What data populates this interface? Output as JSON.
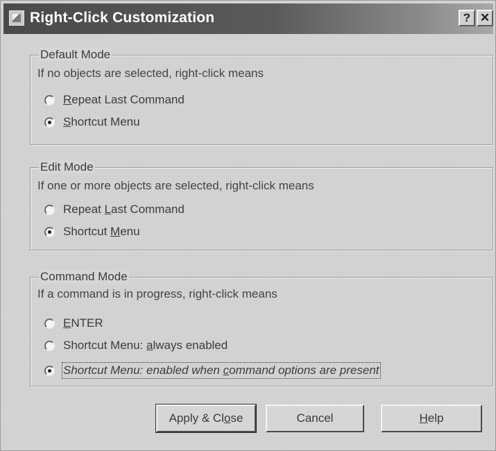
{
  "window": {
    "title": "Right-Click Customization",
    "help_glyph": "?",
    "close_glyph": "✕"
  },
  "default_mode": {
    "legend": "Default Mode",
    "description": "If no objects are selected, right-click means",
    "options": [
      {
        "before": "",
        "mnemonic": "R",
        "after": "epeat Last Command",
        "selected": false
      },
      {
        "before": "",
        "mnemonic": "S",
        "after": "hortcut Menu",
        "selected": true
      }
    ]
  },
  "edit_mode": {
    "legend": "Edit Mode",
    "description": "If one or more objects are selected, right-click means",
    "options": [
      {
        "before": "Repeat ",
        "mnemonic": "L",
        "after": "ast Command",
        "selected": false
      },
      {
        "before": "Shortcut ",
        "mnemonic": "M",
        "after": "enu",
        "selected": true
      }
    ]
  },
  "command_mode": {
    "legend": "Command Mode",
    "description": "If a command is in progress, right-click means",
    "options": [
      {
        "before": "",
        "mnemonic": "E",
        "after": "NTER",
        "selected": false
      },
      {
        "before": "Shortcut Menu: ",
        "mnemonic": "a",
        "after": "lways enabled",
        "selected": false
      },
      {
        "before": "Shortcut Menu: enabled when ",
        "mnemonic": "c",
        "after": "ommand options are present",
        "selected": true
      }
    ]
  },
  "buttons": {
    "apply_close": {
      "before": "Apply & Cl",
      "mnemonic": "o",
      "after": "se"
    },
    "cancel": "Cancel",
    "help": {
      "before": "",
      "mnemonic": "H",
      "after": "elp"
    }
  }
}
